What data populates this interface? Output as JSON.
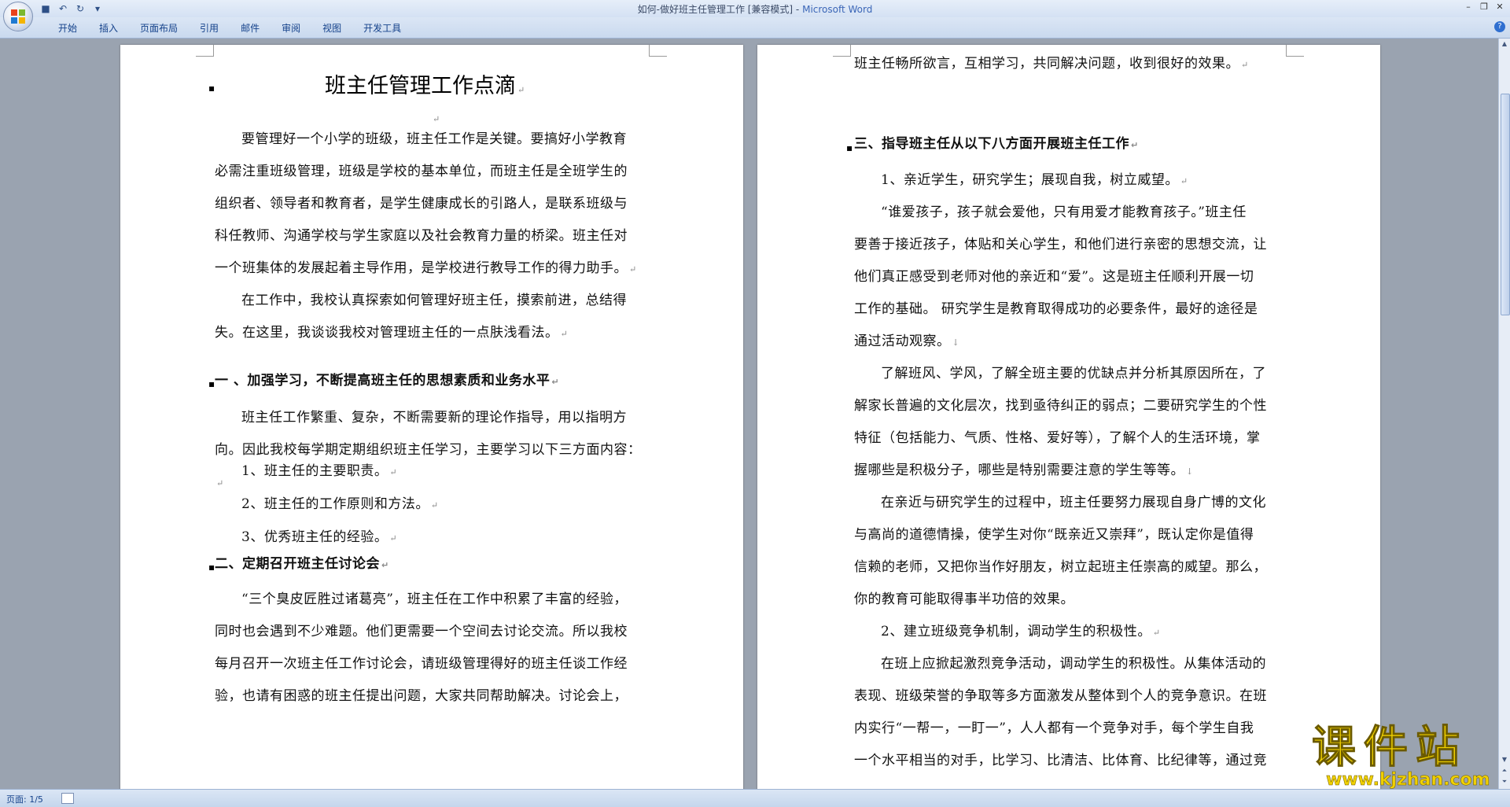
{
  "window": {
    "title_doc": "如何-做好班主任管理工作 [兼容模式] -",
    "title_app": "Microsoft Word"
  },
  "ribbon": {
    "tabs": [
      "开始",
      "插入",
      "页面布局",
      "引用",
      "邮件",
      "审阅",
      "视图",
      "开发工具"
    ]
  },
  "page_left": {
    "title": "班主任管理工作点滴",
    "intro_p1": [
      "要管理好一个小学的班级，班主任工作是关键。要搞好小学教育",
      "必需注重班级管理，班级是学校的基本单位，而班主任是全班学生的",
      "组织者、领导者和教育者，是学生健康成长的引路人，是联系班级与",
      "科任教师、沟通学校与学生家庭以及社会教育力量的桥梁。班主任对",
      "一个班集体的发展起着主导作用，是学校进行教导工作的得力助手。"
    ],
    "intro_p2": [
      "在工作中，我校认真探索如何管理好班主任，摸索前进，总结得",
      "失。在这里，我谈谈我校对管理班主任的一点肤浅看法。"
    ],
    "heading1": "一 、加强学习，不断提高班主任的思想素质和业务水平",
    "h1_p1": [
      "班主任工作繁重、复杂，不断需要新的理论作指导，用以指明方",
      "向。因此我校每学期定期组织班主任学习，主要学习以下三方面内容："
    ],
    "h1_list": [
      "1、班主任的主要职责。",
      "2、班主任的工作原则和方法。",
      "3、优秀班主任的经验。"
    ],
    "heading2": "二、定期召开班主任讨论会",
    "h2_p1": [
      "“三个臭皮匠胜过诸葛亮”，班主任在工作中积累了丰富的经验，",
      "同时也会遇到不少难题。他们更需要一个空间去讨论交流。所以我校",
      "每月召开一次班主任工作讨论会，请班级管理得好的班主任谈工作经",
      "验，也请有困惑的班主任提出问题，大家共同帮助解决。讨论会上，"
    ]
  },
  "page_right": {
    "cont": "班主任畅所欲言，互相学习，共同解决问题，收到很好的效果。",
    "heading3": "三、指导班主任从以下八方面开展班主任工作",
    "item1": "1、亲近学生，研究学生；展现自我，树立威望。",
    "p_a": [
      "“谁爱孩子，孩子就会爱他，只有用爱才能教育孩子。”班主任",
      "要善于接近孩子，体贴和关心学生，和他们进行亲密的思想交流，让",
      "他们真正感受到老师对他的亲近和“爱”。这是班主任顺利开展一切",
      "工作的基础。 研究学生是教育取得成功的必要条件，最好的途径是",
      "通过活动观察。"
    ],
    "p_b": [
      "了解班风、学风，了解全班主要的优缺点并分析其原因所在，了",
      "解家长普遍的文化层次，找到亟待纠正的弱点；二要研究学生的个性",
      "特征（包括能力、气质、性格、爱好等），了解个人的生活环境，掌",
      "握哪些是积极分子，哪些是特别需要注意的学生等等。"
    ],
    "p_c": [
      "在亲近与研究学生的过程中，班主任要努力展现自身广博的文化",
      "与高尚的道德情操，使学生对你“既亲近又崇拜”，既认定你是值得",
      "信赖的老师，又把你当作好朋友，树立起班主任崇高的威望。那么，",
      "你的教育可能取得事半功倍的效果。"
    ],
    "item2": "2、建立班级竞争机制，调动学生的积极性。",
    "p_d": [
      "在班上应掀起激烈竞争活动，调动学生的积极性。从集体活动的",
      "表现、班级荣誉的争取等多方面激发从整体到个人的竞争意识。在班",
      "内实行“一帮一，一盯一”，人人都有一个竞争对手，每个学生自我",
      "一个水平相当的对手，比学习、比清洁、比体育、比纪律等，通过竞"
    ]
  },
  "status": {
    "page_indicator": "页面: 1/5"
  },
  "watermark": {
    "cn": "课件站",
    "url": "www.kjzhan.com"
  }
}
